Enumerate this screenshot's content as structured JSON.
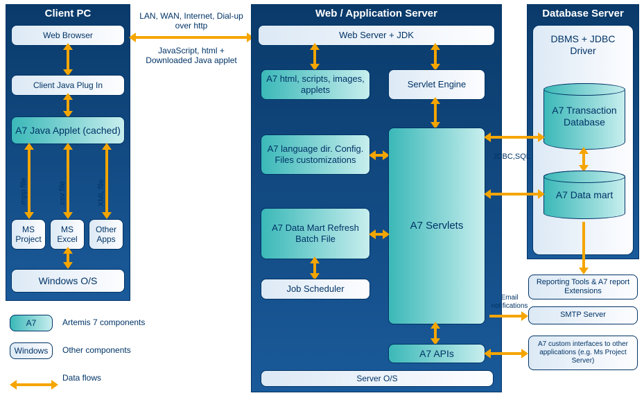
{
  "columns": {
    "client": {
      "title": "Client PC"
    },
    "app": {
      "title": "Web / Application Server"
    },
    "db": {
      "title": "Database Server"
    }
  },
  "client": {
    "browser": "Web Browser",
    "plugin": "Client Java Plug In",
    "applet": "A7 Java Applet (cached)",
    "msproject": "MS Project",
    "msexcel": "MS Excel",
    "otherapps": "Other Apps",
    "os": "Windows O/S",
    "file_mpp": ".mpp file",
    "file_csv": ".csv file",
    "file_xml": "XML file"
  },
  "between_client_app": {
    "line1": "LAN, WAN, Internet, Dial-up over http",
    "line2": "JavaScript, html + Downloaded Java applet"
  },
  "app": {
    "webserver": "Web Server + JDK",
    "html": "A7 html, scripts, images, applets",
    "servlet_engine": "Servlet Engine",
    "langdir": "A7 language dir. Config. Files customizations",
    "servlets": "A7 Servlets",
    "datamart_batch": "A7 Data Mart Refresh Batch File",
    "jobsched": "Job Scheduler",
    "apis": "A7 APIs",
    "serveros": "Server O/S"
  },
  "db": {
    "dbms": "DBMS + JDBC Driver",
    "txndb": "A7 Transaction Database",
    "datamart": "A7 Data mart",
    "jdbc_label": "JDBC,SQL",
    "reporting": "Reporting Tools & A7 report Extensions",
    "smtp": "SMTP Server",
    "email_label": "Email notifications",
    "custom": "A7 custom interfaces to other applications (e.g. Ms Project Server)"
  },
  "legend": {
    "a7": "A7",
    "a7_desc": "Artemis 7 components",
    "win": "Windows",
    "win_desc": "Other components",
    "flows": "Data flows"
  }
}
